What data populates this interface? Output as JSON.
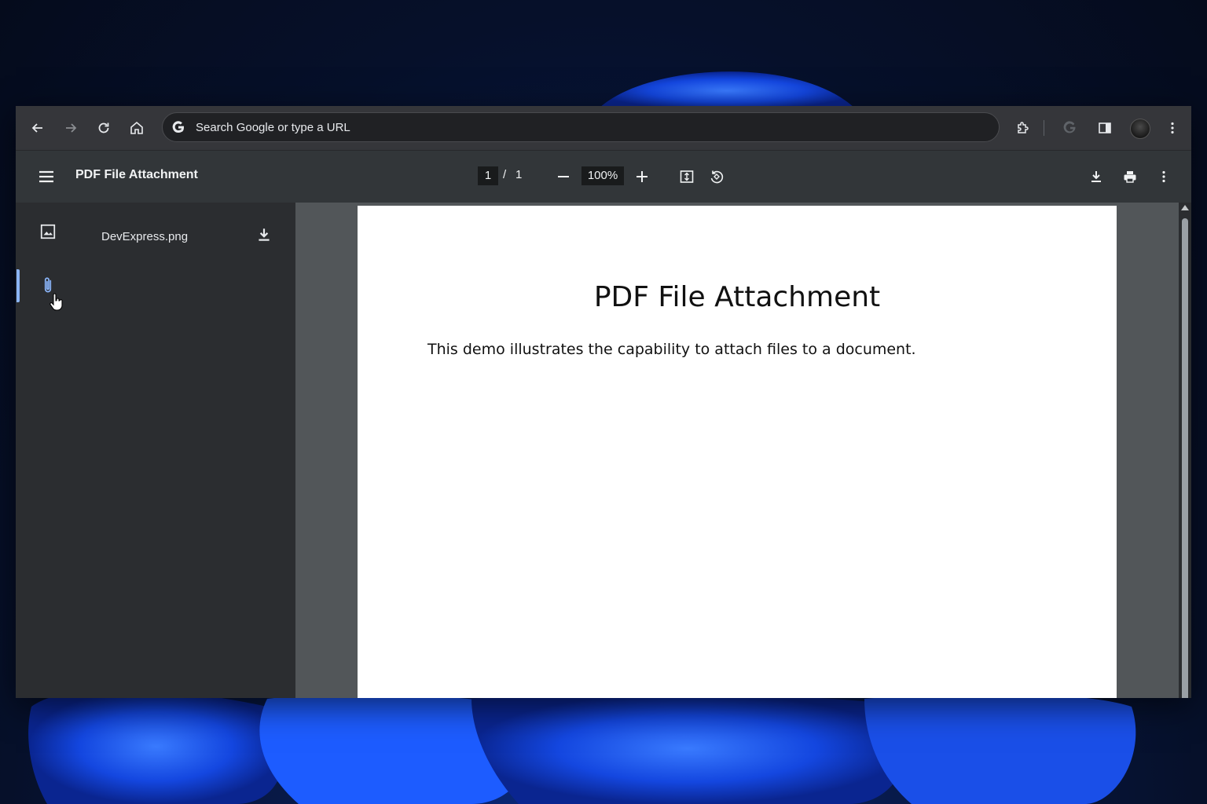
{
  "browser": {
    "omnibox_placeholder": "Search Google or type a URL"
  },
  "pdf_toolbar": {
    "title": "PDF File Attachment",
    "current_page": "1",
    "page_separator": "/",
    "total_pages": "1",
    "zoom": "100%"
  },
  "sidebar": {
    "attachments": [
      {
        "name": "DevExpress.png"
      }
    ]
  },
  "document": {
    "title": "PDF File Attachment",
    "body": "This demo illustrates the capability to attach files to a document."
  },
  "colors": {
    "accent": "#8ab4f8",
    "toolbar_bg": "#35363a",
    "pdfbar_bg": "#323639",
    "sidebar_bg": "#2b2d30",
    "doc_bg": "#525659"
  },
  "icons": [
    "back-icon",
    "forward-icon",
    "reload-icon",
    "home-icon",
    "google-icon",
    "extensions-icon",
    "google-account-icon",
    "side-panel-icon",
    "more-vert-icon",
    "menu-icon",
    "zoom-out-icon",
    "zoom-in-icon",
    "fit-page-icon",
    "rotate-icon",
    "download-icon",
    "print-icon",
    "image-icon",
    "attachment-icon"
  ]
}
